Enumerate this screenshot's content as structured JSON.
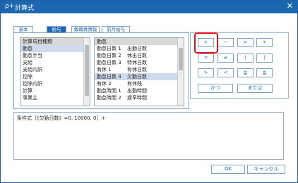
{
  "window": {
    "title": "計算式",
    "title_icon": "ρ+"
  },
  "tabs": [
    "基本",
    "給与",
    "教職員情報",
    "前月給与"
  ],
  "left_list": {
    "header": "計算項目種類",
    "items": [
      "勤怠",
      "勤怠手当",
      "支給",
      "支給内訳",
      "控除",
      "控除内訳",
      "計算",
      "事業主"
    ]
  },
  "right_list": {
    "header": "勤怠",
    "items": [
      [
        "勤怠日数 1",
        "出勤日数"
      ],
      [
        "勤怠日数 2",
        "休出日数"
      ],
      [
        "勤怠日数 3",
        "特休日数"
      ],
      [
        "有休 1",
        "有休日数"
      ],
      [
        "勤怠日数 4",
        "欠勤日数"
      ],
      [
        "有休 2",
        "有休残"
      ],
      [
        "勤怠時間 1",
        "出勤時間"
      ],
      [
        "勤怠時間 2",
        "遅早時間"
      ]
    ]
  },
  "operators": {
    "plus": "+",
    "minus": "−",
    "times": "×",
    "divide": "÷",
    "equal": "=",
    "not_equal": "≠",
    "lparen": "(",
    "rparen": ")",
    "gt": ">",
    "lt": "<",
    "ge": "≧",
    "le": "≦",
    "and": "かつ",
    "or": "または"
  },
  "formula": {
    "text": "条件式［《欠勤日数》=0, 10000, 0］+"
  },
  "buttons": {
    "ok": "OK",
    "cancel": "キャンセル"
  }
}
